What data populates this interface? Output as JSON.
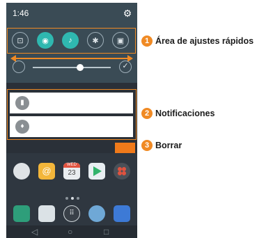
{
  "status": {
    "time": "1:46"
  },
  "quick_settings": [
    {
      "icon": "screen-capture-icon",
      "glyph": "⊡",
      "on": false
    },
    {
      "icon": "wifi-icon",
      "glyph": "◉",
      "on": true
    },
    {
      "icon": "sound-icon",
      "glyph": "♪",
      "on": true
    },
    {
      "icon": "bluetooth-icon",
      "glyph": "✱",
      "on": false
    },
    {
      "icon": "nfc-icon",
      "glyph": "▣",
      "on": false
    }
  ],
  "brightness": {
    "level": 0.55
  },
  "notifications": [
    {
      "icon": "battery-icon",
      "glyph": "▮"
    },
    {
      "icon": "bulb-icon",
      "glyph": "♦"
    }
  ],
  "home": {
    "calendar_day": "23",
    "calendar_month": "WED"
  },
  "nav": {
    "back": "◁",
    "home": "○",
    "recents": "□"
  },
  "callouts": [
    {
      "num": "1",
      "text": "Área de ajustes rápidos"
    },
    {
      "num": "2",
      "text": "Notificaciones"
    },
    {
      "num": "3",
      "text": "Borrar"
    }
  ],
  "colors": {
    "accent": "#f08a24",
    "teal": "#2fb8b0",
    "clear": "#f07a1a"
  }
}
